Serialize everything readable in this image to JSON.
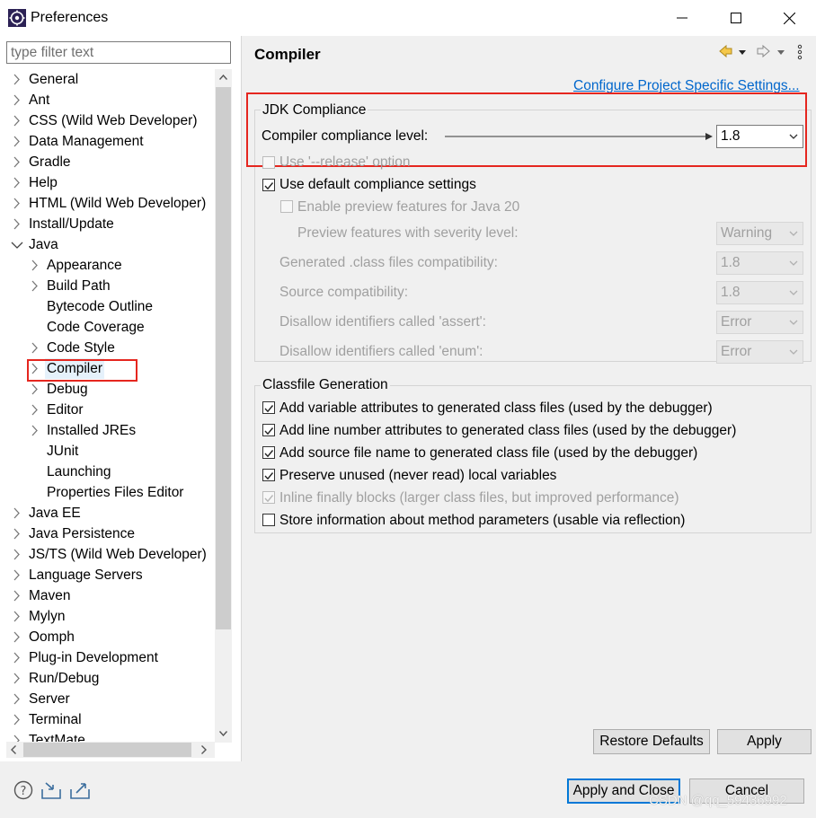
{
  "window": {
    "title": "Preferences",
    "minimize_glyph": "—",
    "maximize_glyph": "☐",
    "close_glyph": "✕"
  },
  "filter": {
    "placeholder": "type filter text",
    "value": ""
  },
  "tree": {
    "items": [
      {
        "label": "General",
        "level": 0,
        "state": "collapsed"
      },
      {
        "label": "Ant",
        "level": 0,
        "state": "collapsed"
      },
      {
        "label": "CSS (Wild Web Developer)",
        "level": 0,
        "state": "collapsed"
      },
      {
        "label": "Data Management",
        "level": 0,
        "state": "collapsed"
      },
      {
        "label": "Gradle",
        "level": 0,
        "state": "collapsed"
      },
      {
        "label": "Help",
        "level": 0,
        "state": "collapsed"
      },
      {
        "label": "HTML (Wild Web Developer)",
        "level": 0,
        "state": "collapsed"
      },
      {
        "label": "Install/Update",
        "level": 0,
        "state": "collapsed"
      },
      {
        "label": "Java",
        "level": 0,
        "state": "expanded"
      },
      {
        "label": "Appearance",
        "level": 1,
        "state": "collapsed"
      },
      {
        "label": "Build Path",
        "level": 1,
        "state": "collapsed"
      },
      {
        "label": "Bytecode Outline",
        "level": 1,
        "state": "leaf"
      },
      {
        "label": "Code Coverage",
        "level": 1,
        "state": "leaf"
      },
      {
        "label": "Code Style",
        "level": 1,
        "state": "collapsed"
      },
      {
        "label": "Compiler",
        "level": 1,
        "state": "collapsed",
        "selected": true
      },
      {
        "label": "Debug",
        "level": 1,
        "state": "collapsed"
      },
      {
        "label": "Editor",
        "level": 1,
        "state": "collapsed"
      },
      {
        "label": "Installed JREs",
        "level": 1,
        "state": "collapsed"
      },
      {
        "label": "JUnit",
        "level": 1,
        "state": "leaf"
      },
      {
        "label": "Launching",
        "level": 1,
        "state": "leaf"
      },
      {
        "label": "Properties Files Editor",
        "level": 1,
        "state": "leaf"
      },
      {
        "label": "Java EE",
        "level": 0,
        "state": "collapsed"
      },
      {
        "label": "Java Persistence",
        "level": 0,
        "state": "collapsed"
      },
      {
        "label": "JS/TS (Wild Web Developer)",
        "level": 0,
        "state": "collapsed"
      },
      {
        "label": "Language Servers",
        "level": 0,
        "state": "collapsed"
      },
      {
        "label": "Maven",
        "level": 0,
        "state": "collapsed"
      },
      {
        "label": "Mylyn",
        "level": 0,
        "state": "collapsed"
      },
      {
        "label": "Oomph",
        "level": 0,
        "state": "collapsed"
      },
      {
        "label": "Plug-in Development",
        "level": 0,
        "state": "collapsed"
      },
      {
        "label": "Run/Debug",
        "level": 0,
        "state": "collapsed"
      },
      {
        "label": "Server",
        "level": 0,
        "state": "collapsed"
      },
      {
        "label": "Terminal",
        "level": 0,
        "state": "collapsed"
      },
      {
        "label": "TextMate",
        "level": 0,
        "state": "collapsed"
      }
    ]
  },
  "page": {
    "title": "Compiler",
    "configure_link": "Configure Project Specific Settings..."
  },
  "jdk": {
    "group_label": "JDK Compliance",
    "compliance_label": "Compiler compliance level:",
    "compliance_value": "1.8",
    "release_option": "Use '--release' option",
    "use_default": "Use default compliance settings",
    "enable_preview": "Enable preview features for Java 20",
    "preview_severity_label": "Preview features with severity level:",
    "preview_severity_value": "Warning",
    "generated_label": "Generated .class files compatibility:",
    "generated_value": "1.8",
    "source_label": "Source compatibility:",
    "source_value": "1.8",
    "assert_label": "Disallow identifiers called 'assert':",
    "assert_value": "Error",
    "enum_label": "Disallow identifiers called 'enum':",
    "enum_value": "Error"
  },
  "classfile": {
    "group_label": "Classfile Generation",
    "options": [
      {
        "label": "Add variable attributes to generated class files (used by the debugger)",
        "checked": true,
        "enabled": true
      },
      {
        "label": "Add line number attributes to generated class files (used by the debugger)",
        "checked": true,
        "enabled": true
      },
      {
        "label": "Add source file name to generated class file (used by the debugger)",
        "checked": true,
        "enabled": true
      },
      {
        "label": "Preserve unused (never read) local variables",
        "checked": true,
        "enabled": true
      },
      {
        "label": "Inline finally blocks (larger class files, but improved performance)",
        "checked": true,
        "enabled": false
      },
      {
        "label": "Store information about method parameters (usable via reflection)",
        "checked": false,
        "enabled": true
      }
    ]
  },
  "buttons": {
    "restore_defaults": "Restore Defaults",
    "apply": "Apply",
    "apply_and_close": "Apply and Close",
    "cancel": "Cancel"
  },
  "watermark": "CSDN @qq_59436992",
  "colors": {
    "highlight_red": "#e5261f",
    "link": "#0066cc",
    "selection": "#e5f1fb"
  }
}
